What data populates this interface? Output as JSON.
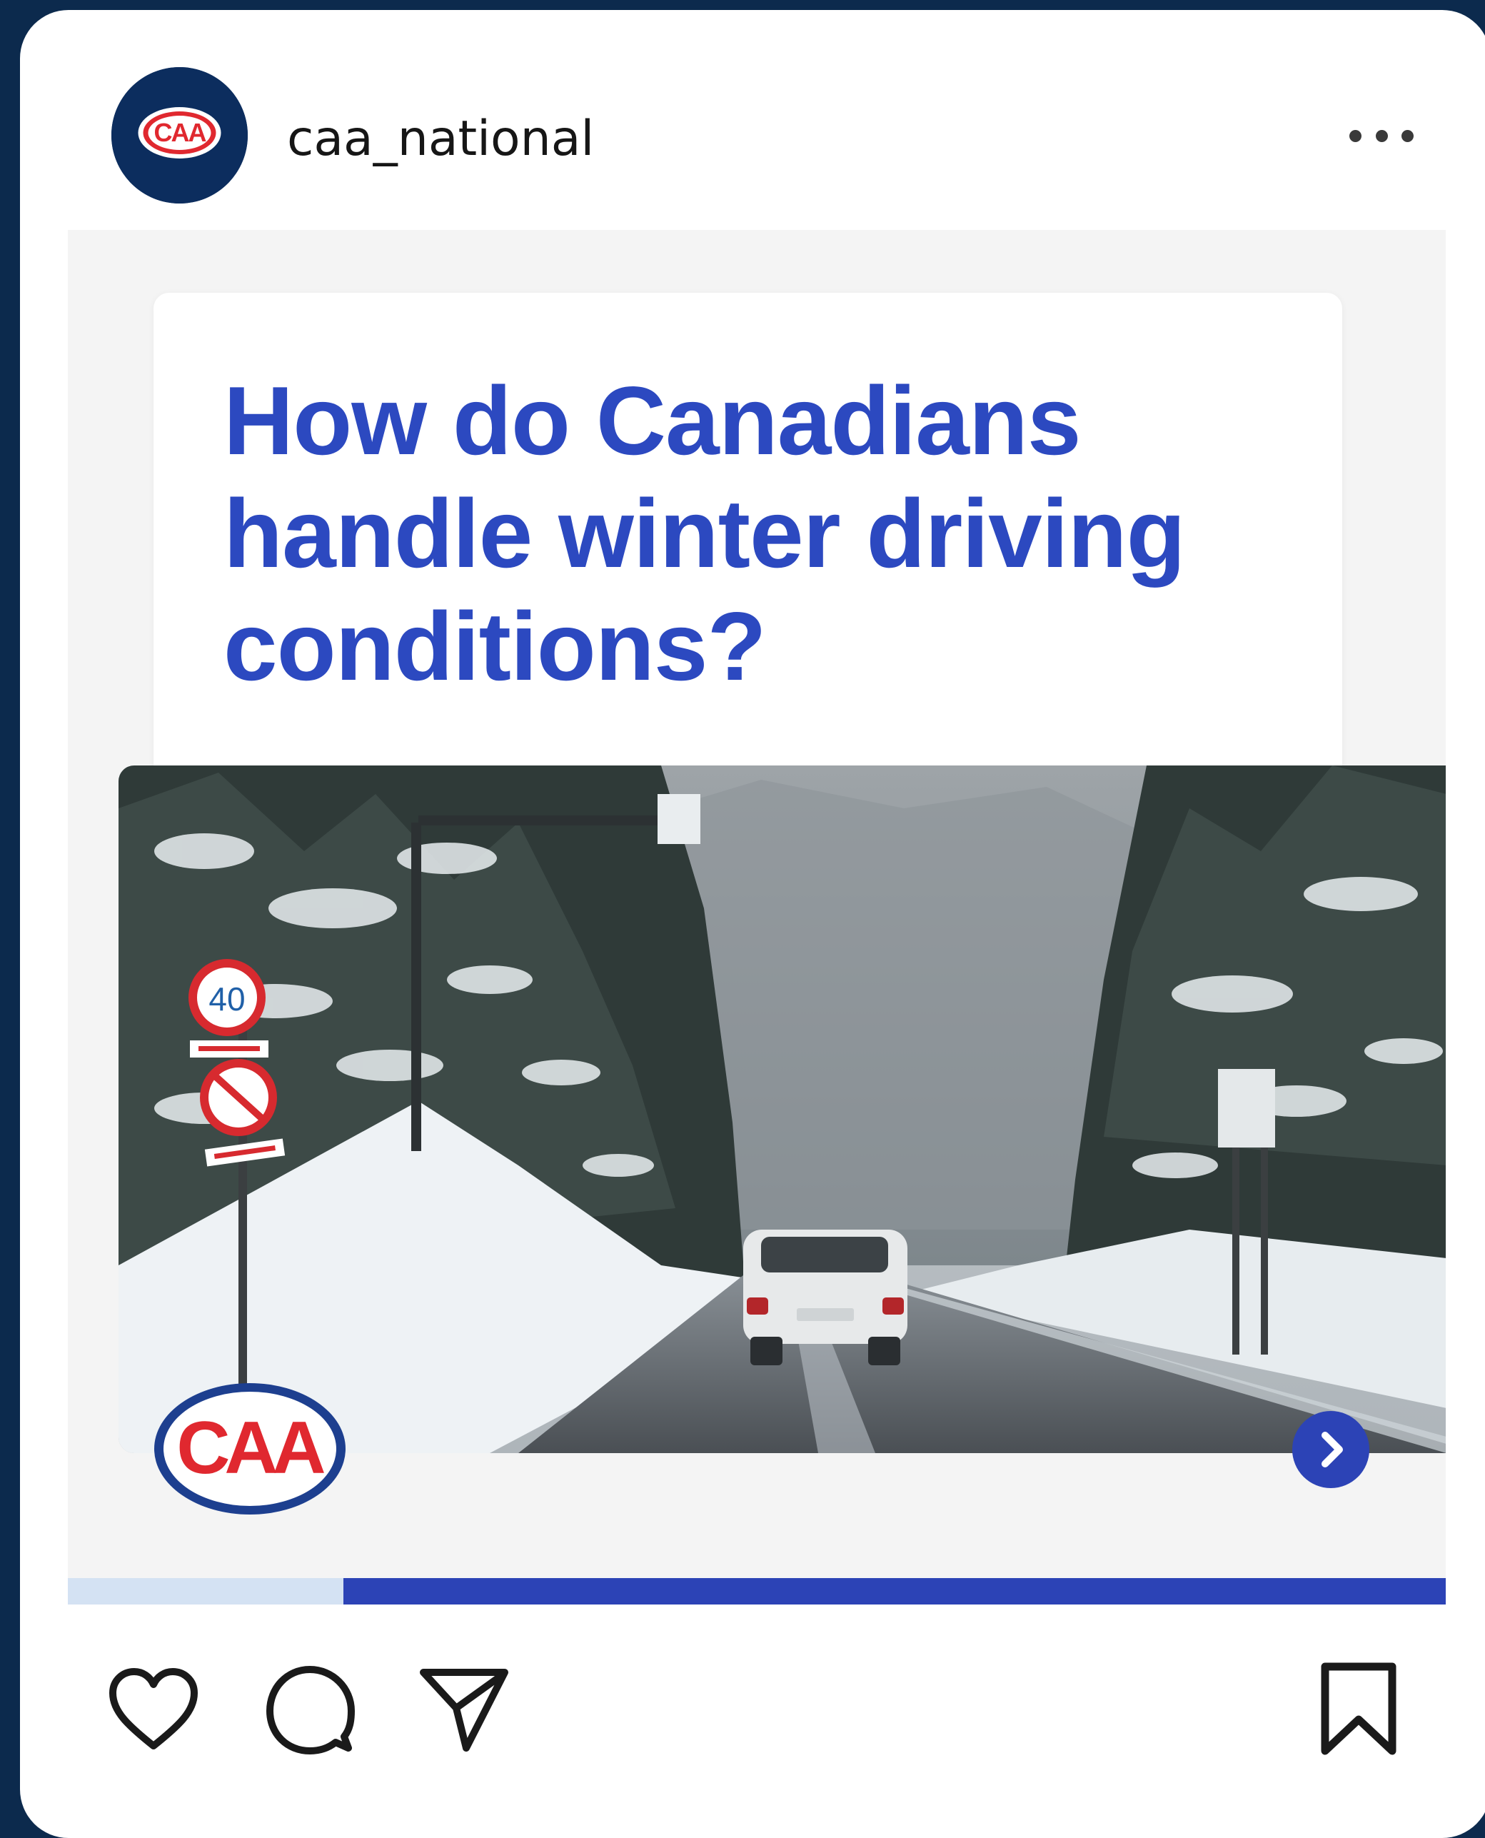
{
  "header": {
    "username": "caa_national",
    "avatar_logo_text": "CAA",
    "more_icon": "more-horizontal-icon"
  },
  "post": {
    "headline": "How do Canadians handle winter driving conditions?",
    "photo_sign_speed": "40",
    "brand_logo_text": "CAA",
    "next_icon": "chevron-right-icon",
    "carousel": {
      "slides_total": 5,
      "active_slide": 1
    }
  },
  "actions": {
    "like_icon": "heart-icon",
    "comment_icon": "comment-icon",
    "share_icon": "send-icon",
    "save_icon": "bookmark-icon"
  },
  "colors": {
    "frame": "#0c2a4d",
    "brand_blue": "#2c49c0",
    "logo_red": "#e0282f",
    "progress_done": "#d4e2f3",
    "progress_remaining": "#2c43b6"
  }
}
